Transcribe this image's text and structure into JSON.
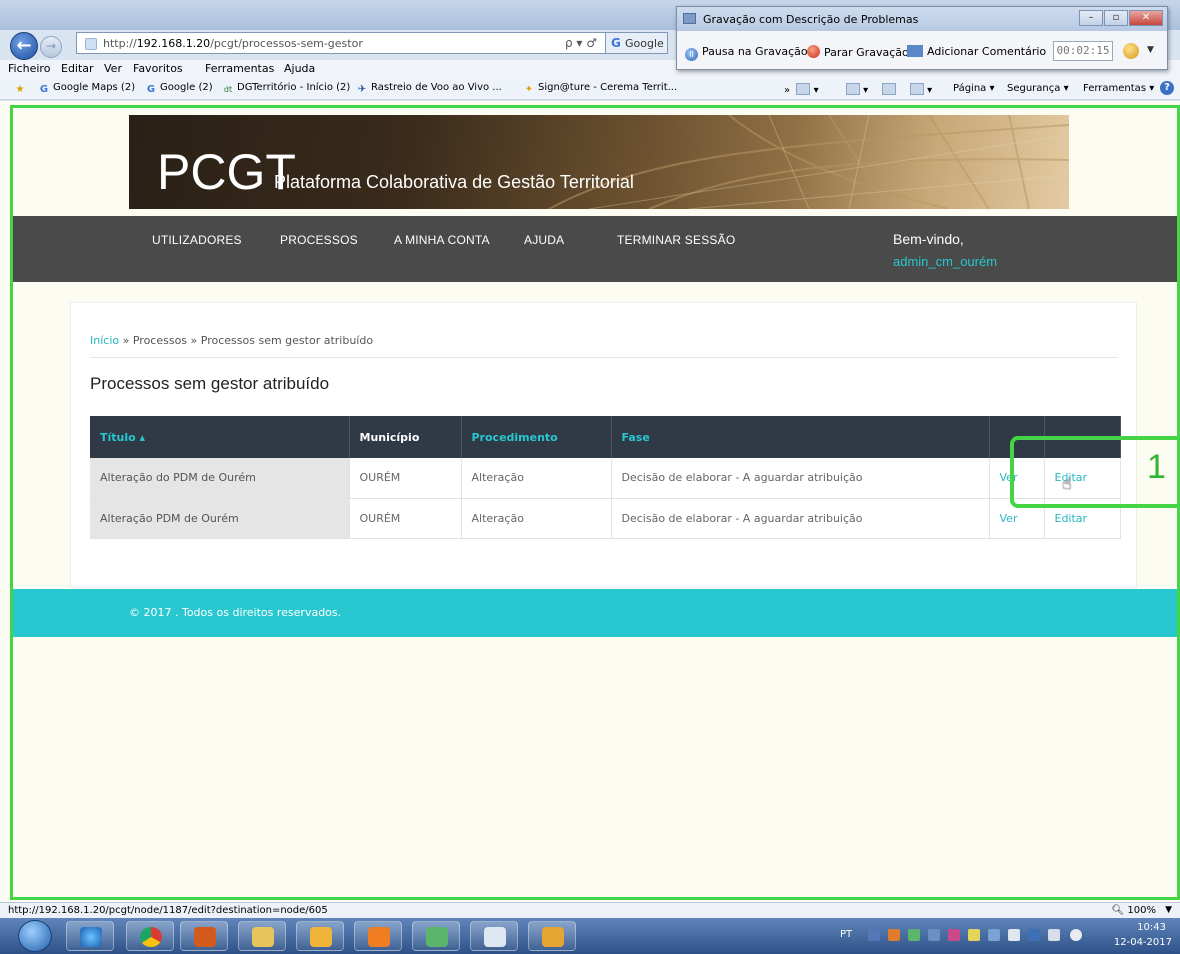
{
  "browser": {
    "address_url_prefix": "http://",
    "address_host": "192.168.1.20",
    "address_path": "/pcgt/processos-sem-gestor",
    "address_tools": "ρ ▾ ♂",
    "search_label": "Google",
    "menu": [
      "Ficheiro",
      "Editar",
      "Ver",
      "Favoritos",
      "Ferramentas",
      "Ajuda"
    ],
    "favorites": [
      {
        "label": "Google Maps (2)",
        "icon": "google-icon"
      },
      {
        "label": "Google (2)",
        "icon": "google-icon"
      },
      {
        "label": "DGTerritório - Início (2)",
        "icon": "dgt-icon"
      },
      {
        "label": "Rastreio de Voo ao Vivo ...",
        "icon": "airplane-icon"
      },
      {
        "label": "Sign@ture - Cerema Territ...",
        "icon": "signature-icon"
      }
    ],
    "command_bar": [
      "Página ▾",
      "Segurança ▾",
      "Ferramentas ▾"
    ],
    "status_url": "http://192.168.1.20/pcgt/node/1187/edit?destination=node/605",
    "zoom": "100%"
  },
  "recorder": {
    "title": "Gravação com Descrição de Problemas",
    "pause": "Pausa na Gravação",
    "stop": "Parar Gravação",
    "comment": "Adicionar Comentário",
    "timer": "00:02:15"
  },
  "site": {
    "logo_main": "PCGT",
    "logo_sub": "Plataforma Colaborativa de Gestão Territorial",
    "nav": [
      "UTILIZADORES",
      "PROCESSOS",
      "A MINHA CONTA",
      "AJUDA",
      "TERMINAR SESSÃO"
    ],
    "welcome": "Bem-vindo,",
    "username": "admin_cm_ourém",
    "breadcrumb": {
      "home": "Início",
      "sep": " » ",
      "section": "Processos",
      "current": "Processos sem gestor atribuído"
    },
    "page_title": "Processos sem gestor atribuído",
    "table": {
      "headers": {
        "title": "Título ▴",
        "municipio": "Município",
        "procedimento": "Procedimento",
        "fase": "Fase"
      },
      "rows": [
        {
          "title": "Alteração do PDM de Ourém",
          "municipio": "OURÉM",
          "procedimento": "Alteração",
          "fase": "Decisão de elaborar - A aguardar atribuição",
          "view": "Ver",
          "edit": "Editar"
        },
        {
          "title": "Alteração PDM de Ourém",
          "municipio": "OURÉM",
          "procedimento": "Alteração",
          "fase": "Decisão de elaborar - A aguardar atribuição",
          "view": "Ver",
          "edit": "Editar"
        }
      ]
    },
    "footer": "© 2017 . Todos os direitos reservados."
  },
  "annotation": {
    "callout_number": "1",
    "highlight_color": "#45d445"
  },
  "taskbar": {
    "lang": "PT",
    "time": "10:43",
    "date": "12-04-2017"
  },
  "colors": {
    "accent_teal": "#29c7cf",
    "nav_dark": "#4a4a4a",
    "table_header": "#2f3a46"
  }
}
